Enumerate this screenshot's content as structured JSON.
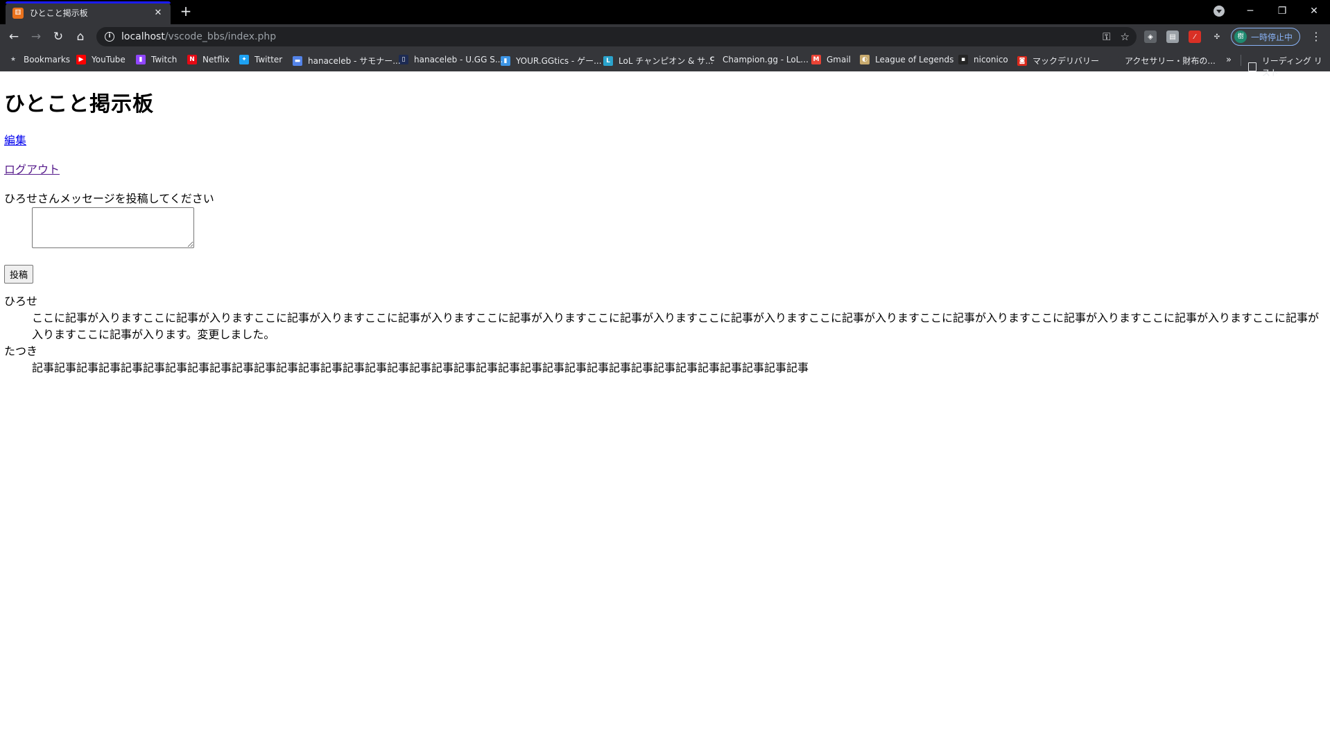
{
  "browser": {
    "tab_title": "ひとこと掲示板",
    "favicon_label": "⚅",
    "new_tab": "+",
    "tab_close": "✕",
    "url_host": "localhost",
    "url_path": "/vscode_bbs/index.php",
    "profile_avatar": "樹",
    "profile_label": "一時停止中",
    "window_controls": {
      "minimize": "─",
      "restore": "❐",
      "close": "✕"
    }
  },
  "bookmarks": {
    "items": [
      {
        "label": "Bookmarks",
        "icon": "star-icon",
        "color": "#bdc1c6"
      },
      {
        "label": "YouTube",
        "icon": "youtube-icon",
        "color": "#ff0000"
      },
      {
        "label": "Twitch",
        "icon": "twitch-icon",
        "color": "#9146ff"
      },
      {
        "label": "Netflix",
        "icon": "netflix-icon",
        "color": "#e50914"
      },
      {
        "label": "Twitter",
        "icon": "twitter-icon",
        "color": "#1da1f2"
      },
      {
        "label": "hanaceleb - サモナー...",
        "icon": "opgg-icon",
        "color": "#5383e8"
      },
      {
        "label": "hanaceleb - U.GG S...",
        "icon": "ugg-icon",
        "color": "#1d2b53"
      },
      {
        "label": "YOUR.GGtics - ゲー...",
        "icon": "yourgg-icon",
        "color": "#3d95e5"
      },
      {
        "label": "LoL チャンピオン & サ...",
        "icon": "lol-l-icon",
        "color": "#2aa3cc"
      },
      {
        "label": "Champion.gg - LoL...",
        "icon": "championgg-icon",
        "color": "#e8eaed"
      },
      {
        "label": "Gmail",
        "icon": "gmail-icon",
        "color": "#ea4335"
      },
      {
        "label": "League of Legends",
        "icon": "lol-icon",
        "color": "#c8aa6e"
      },
      {
        "label": "niconico",
        "icon": "niconico-icon",
        "color": "#252525"
      },
      {
        "label": "マックデリバリー",
        "icon": "mcdelivery-icon",
        "color": "#da291c"
      },
      {
        "label": "アクセサリー・財布の...",
        "icon": "blank-icon",
        "color": "#35363a"
      }
    ],
    "more": "»",
    "reading_list": "リーディング リスト"
  },
  "page": {
    "title": "ひとこと掲示板",
    "edit_link": "編集",
    "logout_link": "ログアウト",
    "prompt": "ひろせさんメッセージを投稿してください",
    "textarea_value": "",
    "submit_label": "投稿",
    "posts": [
      {
        "author": "ひろせ",
        "message": "ここに記事が入りますここに記事が入りますここに記事が入りますここに記事が入りますここに記事が入りますここに記事が入りますここに記事が入りますここに記事が入りますここに記事が入りますここに記事が入りますここに記事が入りますここに記事が入りますここに記事が入ります。変更しました。"
      },
      {
        "author": "たつき",
        "message": "記事記事記事記事記事記事記事記事記事記事記事記事記事記事記事記事記事記事記事記事記事記事記事記事記事記事記事記事記事記事記事記事記事記事記事"
      }
    ]
  }
}
